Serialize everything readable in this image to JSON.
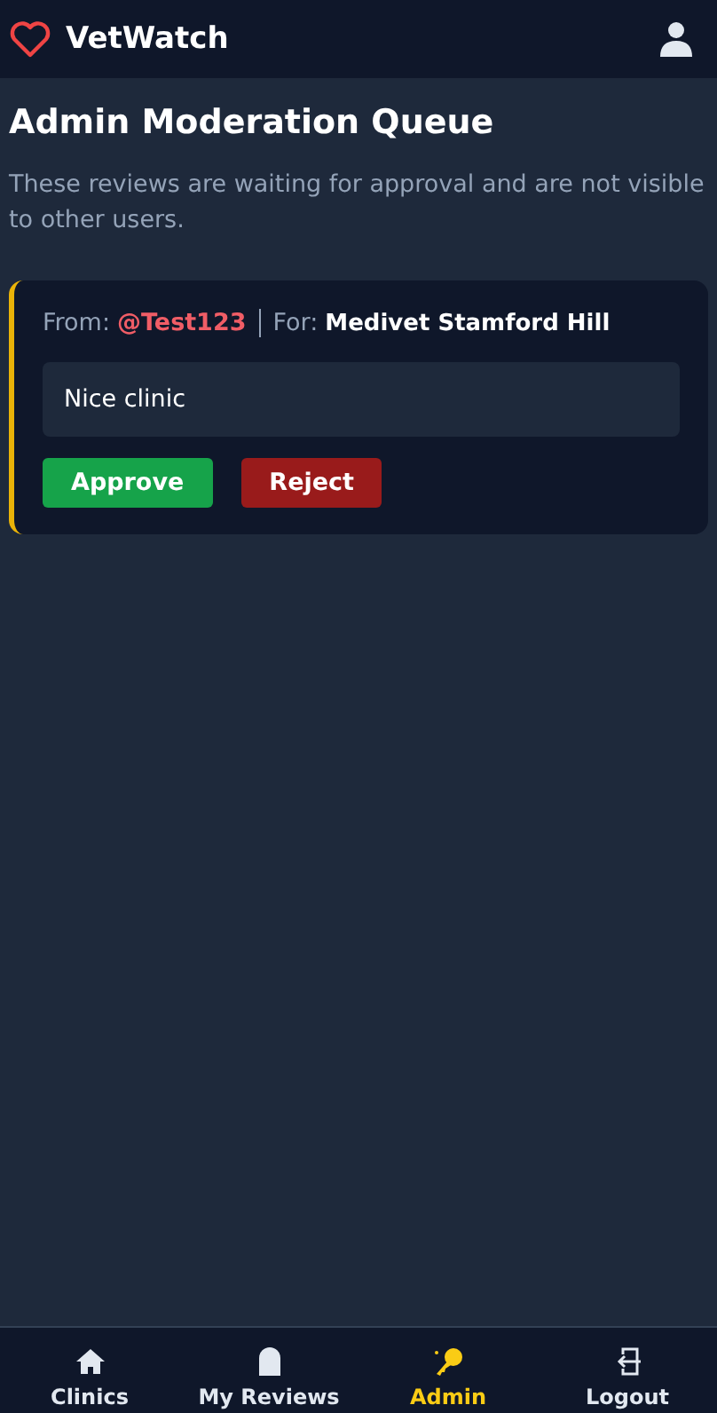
{
  "header": {
    "title": "VetWatch"
  },
  "page": {
    "title": "Admin Moderation Queue",
    "subtitle": "These reviews are waiting for approval and are not visible to other users."
  },
  "reviews": [
    {
      "from_label": "From:",
      "author": "@Test123",
      "for_label": "For:",
      "clinic": "Medivet Stamford Hill",
      "text": "Nice clinic",
      "buttons": [
        "Approve",
        "Reject"
      ]
    }
  ],
  "nav": [
    {
      "kind": "home",
      "label": "Clinics",
      "selected": false
    },
    {
      "kind": "reviews",
      "label": "My Reviews",
      "selected": false
    },
    {
      "kind": "admin",
      "label": "Admin",
      "selected": true
    },
    {
      "kind": "logout",
      "label": "Logout",
      "selected": false
    }
  ]
}
